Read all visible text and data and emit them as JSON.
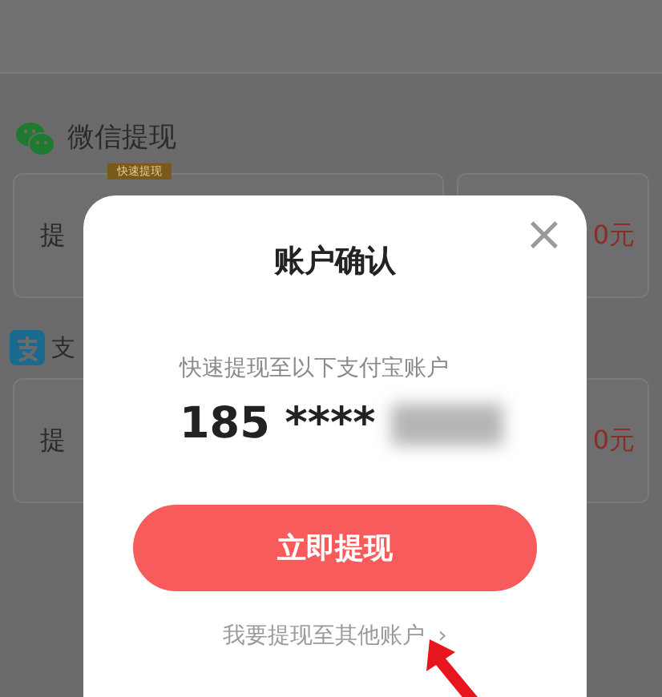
{
  "background_page": {
    "sections": [
      {
        "kind": "wechat",
        "title": "微信提现",
        "badge": "快速提现",
        "card_label": "提",
        "card_amount": "0元"
      },
      {
        "kind": "alipay",
        "title": "支",
        "card_label": "提",
        "card_amount": "0元"
      }
    ]
  },
  "dialog": {
    "title": "账户确认",
    "close": "×",
    "subtitle": "快速提现至以下支付宝账户",
    "account": "185 ****",
    "account_masked": true,
    "button": "立即提现",
    "other_link": "我要提现至其他账户",
    "other_chevron": "›"
  }
}
